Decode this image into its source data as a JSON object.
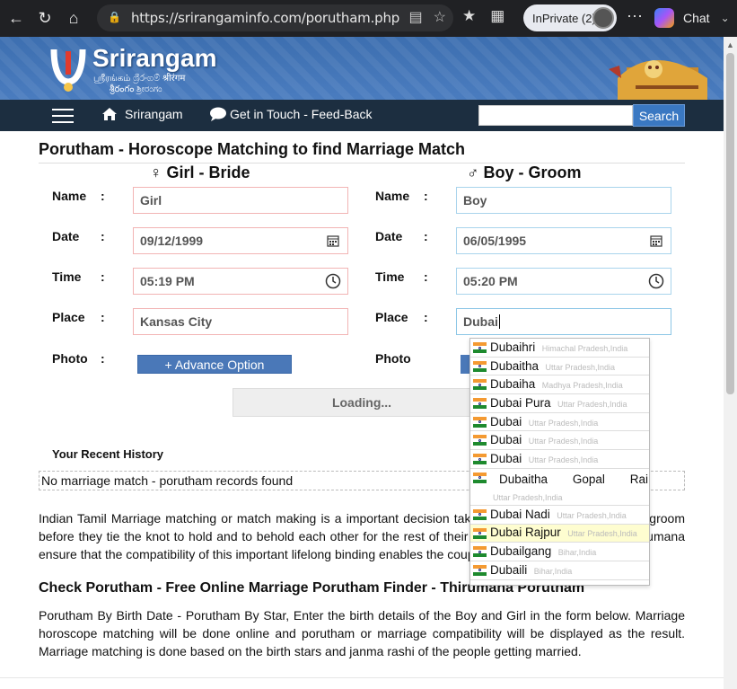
{
  "browser": {
    "url": "https://srirangaminfo.com/porutham.php",
    "inprivate_label": "InPrivate (2)",
    "chat_label": "Chat"
  },
  "site": {
    "brand": "Srirangam",
    "brand_sub_1": "ஸ்ரீரங்கம் ශ්‍රීරංගම් श्रीरंगम",
    "brand_sub_2": "శ్రీరంగం ಶ್ರೀರಂಗಂ",
    "nav": {
      "home_label": "Srirangam",
      "feedback_label": "Get in Touch - Feed-Back",
      "search_placeholder": "",
      "search_button": "Search"
    }
  },
  "form": {
    "title": "Porutham - Horoscope Matching to find Marriage Match",
    "girl_heading": "Girl - Bride",
    "boy_heading": "Boy - Groom",
    "girl_symbol": "♀",
    "boy_symbol": "♂",
    "labels": {
      "name": "Name",
      "date": "Date",
      "time": "Time",
      "place": "Place",
      "photo": "Photo",
      "colon": ":"
    },
    "girl": {
      "name": "Girl",
      "date": "09/12/1999",
      "time": "05:19 PM",
      "place": "Kansas City"
    },
    "boy": {
      "name": "Boy",
      "date": "06/05/1995",
      "time": "05:20 PM",
      "place": "Dubai"
    },
    "advance_option": "+ Advance Option",
    "loading": "Loading..."
  },
  "autocomplete": [
    {
      "name": "Dubaihri",
      "region": "Himachal Pradesh,India"
    },
    {
      "name": "Dubaitha",
      "region": "Uttar Pradesh,India"
    },
    {
      "name": "Dubaiha",
      "region": "Madhya Pradesh,India"
    },
    {
      "name": "Dubai Pura",
      "region": "Uttar Pradesh,India"
    },
    {
      "name": "Dubai",
      "region": "Uttar Pradesh,India"
    },
    {
      "name": "Dubai",
      "region": "Uttar Pradesh,India"
    },
    {
      "name": "Dubai",
      "region": "Uttar Pradesh,India"
    },
    {
      "name": "Dubaitha Gopal Rai",
      "region": "Uttar Pradesh,India"
    },
    {
      "name": "Dubai Nadi",
      "region": "Uttar Pradesh,India"
    },
    {
      "name": "Dubai Rajpur",
      "region": "Uttar Pradesh,India"
    },
    {
      "name": "Dubailgang",
      "region": "Bihar,India"
    },
    {
      "name": "Dubaili",
      "region": "Bihar,India"
    }
  ],
  "history": {
    "title": "Your Recent History",
    "empty_text": "No marriage match - porutham records found"
  },
  "content": {
    "para1": "Indian Tamil Marriage matching or match making is a important decision taken by parents of the bride and groom before they tie the knot to hold and to behold each other for the rest of their lives. This Porutham Tamil Thirumana ensure that the compatibility of this important lifelong binding enables the couple to live 'Blissfully Ever After'.",
    "subtitle": "Check Porutham - Free Online Marriage Porutham Finder - Thirumana Porutham",
    "para2": "Porutham By Birth Date - Porutham By Star, Enter the birth details of the Boy and Girl in the form below. Marriage horoscope matching will be done online and porutham or marriage compatibility will be displayed as the result. Marriage matching is done based on the birth stars and janma rashi of the people getting married."
  },
  "colors": {
    "header_blue": "#3d6fb0",
    "nav_dark": "#1c2e40",
    "search_button": "#3a78c2",
    "girl_border": "#f2b4b4",
    "boy_border": "#a9d4ec",
    "highlight": "#fefdd0"
  },
  "icons": [
    "back-arrow-icon",
    "refresh-icon",
    "home-icon",
    "lock-icon",
    "reader-icon",
    "star-icon",
    "favorites-icon",
    "extensions-icon",
    "more-icon",
    "copilot-icon",
    "hamburger-icon",
    "home-nav-icon",
    "chat-bubble-icon",
    "calendar-icon",
    "clock-icon",
    "flag-india-icon"
  ]
}
